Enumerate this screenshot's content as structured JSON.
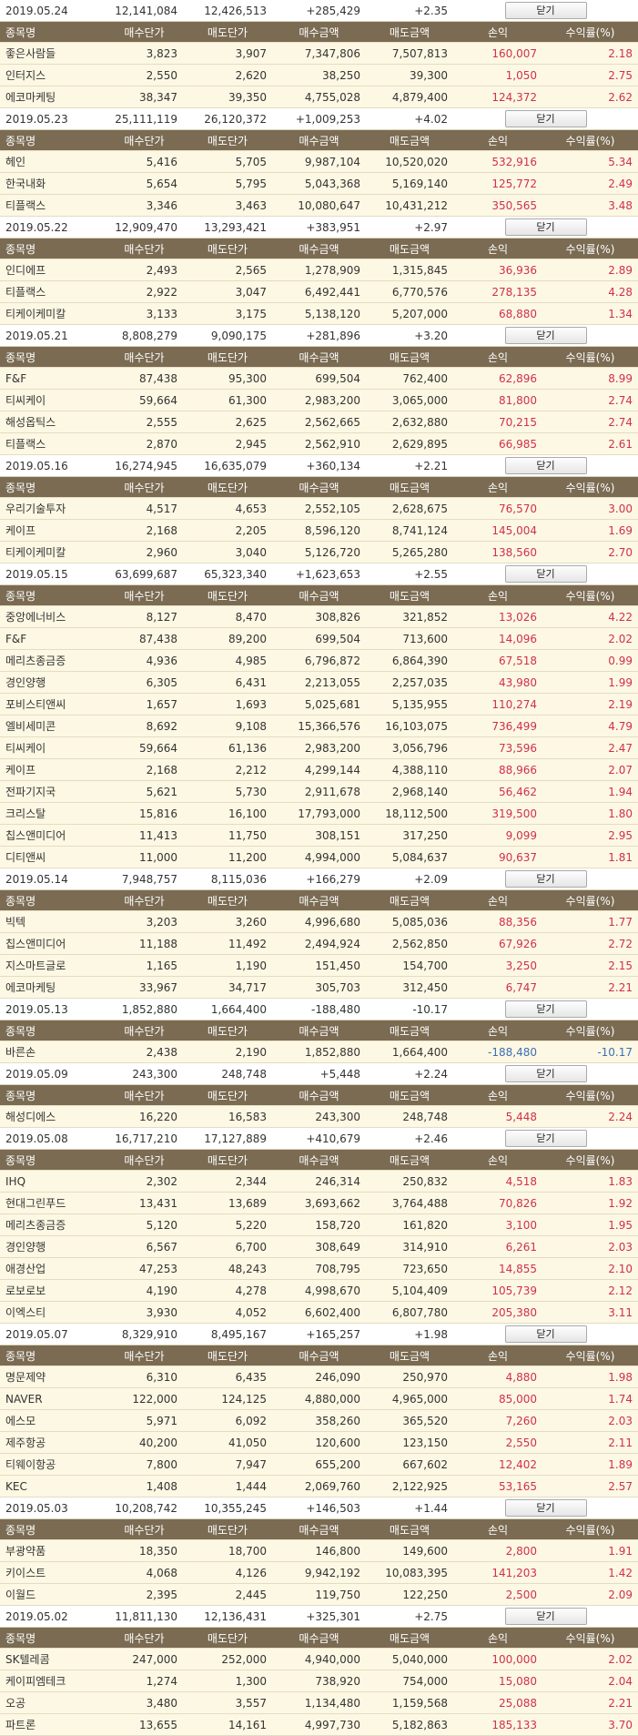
{
  "headers": [
    "종목명",
    "매수단가",
    "매도단가",
    "매수금액",
    "매도금액",
    "손익",
    "수익률(%)"
  ],
  "close_label": "닫기",
  "colors": {
    "positive": "#d0304a",
    "negative": "#3a6fb8",
    "header_bg": "#7a6b52",
    "row_bg": "#fdf8e3"
  },
  "groups": [
    {
      "date": "2019.05.24",
      "buy_total": "12,141,084",
      "sell_total": "12,426,513",
      "profit": "+285,429",
      "rate": "+2.35",
      "rows": [
        [
          "좋은사람들",
          "3,823",
          "3,907",
          "7,347,806",
          "7,507,813",
          "160,007",
          "2.18"
        ],
        [
          "인터지스",
          "2,550",
          "2,620",
          "38,250",
          "39,300",
          "1,050",
          "2.75"
        ],
        [
          "에코마케팅",
          "38,347",
          "39,350",
          "4,755,028",
          "4,879,400",
          "124,372",
          "2.62"
        ]
      ]
    },
    {
      "date": "2019.05.23",
      "buy_total": "25,111,119",
      "sell_total": "26,120,372",
      "profit": "+1,009,253",
      "rate": "+4.02",
      "rows": [
        [
          "헤인",
          "5,416",
          "5,705",
          "9,987,104",
          "10,520,020",
          "532,916",
          "5.34"
        ],
        [
          "한국내화",
          "5,654",
          "5,795",
          "5,043,368",
          "5,169,140",
          "125,772",
          "2.49"
        ],
        [
          "티플랙스",
          "3,346",
          "3,463",
          "10,080,647",
          "10,431,212",
          "350,565",
          "3.48"
        ]
      ]
    },
    {
      "date": "2019.05.22",
      "buy_total": "12,909,470",
      "sell_total": "13,293,421",
      "profit": "+383,951",
      "rate": "+2.97",
      "rows": [
        [
          "인디에프",
          "2,493",
          "2,565",
          "1,278,909",
          "1,315,845",
          "36,936",
          "2.89"
        ],
        [
          "티플랙스",
          "2,922",
          "3,047",
          "6,492,441",
          "6,770,576",
          "278,135",
          "4.28"
        ],
        [
          "티케이케미칼",
          "3,133",
          "3,175",
          "5,138,120",
          "5,207,000",
          "68,880",
          "1.34"
        ]
      ]
    },
    {
      "date": "2019.05.21",
      "buy_total": "8,808,279",
      "sell_total": "9,090,175",
      "profit": "+281,896",
      "rate": "+3.20",
      "rows": [
        [
          "F&F",
          "87,438",
          "95,300",
          "699,504",
          "762,400",
          "62,896",
          "8.99"
        ],
        [
          "티씨케이",
          "59,664",
          "61,300",
          "2,983,200",
          "3,065,000",
          "81,800",
          "2.74"
        ],
        [
          "해성옵틱스",
          "2,555",
          "2,625",
          "2,562,665",
          "2,632,880",
          "70,215",
          "2.74"
        ],
        [
          "티플랙스",
          "2,870",
          "2,945",
          "2,562,910",
          "2,629,895",
          "66,985",
          "2.61"
        ]
      ]
    },
    {
      "date": "2019.05.16",
      "buy_total": "16,274,945",
      "sell_total": "16,635,079",
      "profit": "+360,134",
      "rate": "+2.21",
      "rows": [
        [
          "우리기술투자",
          "4,517",
          "4,653",
          "2,552,105",
          "2,628,675",
          "76,570",
          "3.00"
        ],
        [
          "케이프",
          "2,168",
          "2,205",
          "8,596,120",
          "8,741,124",
          "145,004",
          "1.69"
        ],
        [
          "티케이케미칼",
          "2,960",
          "3,040",
          "5,126,720",
          "5,265,280",
          "138,560",
          "2.70"
        ]
      ]
    },
    {
      "date": "2019.05.15",
      "buy_total": "63,699,687",
      "sell_total": "65,323,340",
      "profit": "+1,623,653",
      "rate": "+2.55",
      "rows": [
        [
          "중앙에너비스",
          "8,127",
          "8,470",
          "308,826",
          "321,852",
          "13,026",
          "4.22"
        ],
        [
          "F&F",
          "87,438",
          "89,200",
          "699,504",
          "713,600",
          "14,096",
          "2.02"
        ],
        [
          "메리츠종금증",
          "4,936",
          "4,985",
          "6,796,872",
          "6,864,390",
          "67,518",
          "0.99"
        ],
        [
          "경인양행",
          "6,305",
          "6,431",
          "2,213,055",
          "2,257,035",
          "43,980",
          "1.99"
        ],
        [
          "포비스티앤씨",
          "1,657",
          "1,693",
          "5,025,681",
          "5,135,955",
          "110,274",
          "2.19"
        ],
        [
          "엘비세미콘",
          "8,692",
          "9,108",
          "15,366,576",
          "16,103,075",
          "736,499",
          "4.79"
        ],
        [
          "티씨케이",
          "59,664",
          "61,136",
          "2,983,200",
          "3,056,796",
          "73,596",
          "2.47"
        ],
        [
          "케이프",
          "2,168",
          "2,212",
          "4,299,144",
          "4,388,110",
          "88,966",
          "2.07"
        ],
        [
          "전파기지국",
          "5,621",
          "5,730",
          "2,911,678",
          "2,968,140",
          "56,462",
          "1.94"
        ],
        [
          "크리스탈",
          "15,816",
          "16,100",
          "17,793,000",
          "18,112,500",
          "319,500",
          "1.80"
        ],
        [
          "칩스앤미디어",
          "11,413",
          "11,750",
          "308,151",
          "317,250",
          "9,099",
          "2.95"
        ],
        [
          "디티앤씨",
          "11,000",
          "11,200",
          "4,994,000",
          "5,084,637",
          "90,637",
          "1.81"
        ]
      ]
    },
    {
      "date": "2019.05.14",
      "buy_total": "7,948,757",
      "sell_total": "8,115,036",
      "profit": "+166,279",
      "rate": "+2.09",
      "rows": [
        [
          "빅텍",
          "3,203",
          "3,260",
          "4,996,680",
          "5,085,036",
          "88,356",
          "1.77"
        ],
        [
          "칩스앤미디어",
          "11,188",
          "11,492",
          "2,494,924",
          "2,562,850",
          "67,926",
          "2.72"
        ],
        [
          "지스마트글로",
          "1,165",
          "1,190",
          "151,450",
          "154,700",
          "3,250",
          "2.15"
        ],
        [
          "에코마케팅",
          "33,967",
          "34,717",
          "305,703",
          "312,450",
          "6,747",
          "2.21"
        ]
      ]
    },
    {
      "date": "2019.05.13",
      "buy_total": "1,852,880",
      "sell_total": "1,664,400",
      "profit": "-188,480",
      "rate": "-10.17",
      "rows": [
        [
          "바른손",
          "2,438",
          "2,190",
          "1,852,880",
          "1,664,400",
          "-188,480",
          "-10.17"
        ]
      ]
    },
    {
      "date": "2019.05.09",
      "buy_total": "243,300",
      "sell_total": "248,748",
      "profit": "+5,448",
      "rate": "+2.24",
      "rows": [
        [
          "해성디에스",
          "16,220",
          "16,583",
          "243,300",
          "248,748",
          "5,448",
          "2.24"
        ]
      ]
    },
    {
      "date": "2019.05.08",
      "buy_total": "16,717,210",
      "sell_total": "17,127,889",
      "profit": "+410,679",
      "rate": "+2.46",
      "rows": [
        [
          "IHQ",
          "2,302",
          "2,344",
          "246,314",
          "250,832",
          "4,518",
          "1.83"
        ],
        [
          "현대그린푸드",
          "13,431",
          "13,689",
          "3,693,662",
          "3,764,488",
          "70,826",
          "1.92"
        ],
        [
          "메리츠종금증",
          "5,120",
          "5,220",
          "158,720",
          "161,820",
          "3,100",
          "1.95"
        ],
        [
          "경인양행",
          "6,567",
          "6,700",
          "308,649",
          "314,910",
          "6,261",
          "2.03"
        ],
        [
          "애경산업",
          "47,253",
          "48,243",
          "708,795",
          "723,650",
          "14,855",
          "2.10"
        ],
        [
          "로보로보",
          "4,190",
          "4,278",
          "4,998,670",
          "5,104,409",
          "105,739",
          "2.12"
        ],
        [
          "이엑스티",
          "3,930",
          "4,052",
          "6,602,400",
          "6,807,780",
          "205,380",
          "3.11"
        ]
      ]
    },
    {
      "date": "2019.05.07",
      "buy_total": "8,329,910",
      "sell_total": "8,495,167",
      "profit": "+165,257",
      "rate": "+1.98",
      "rows": [
        [
          "명문제약",
          "6,310",
          "6,435",
          "246,090",
          "250,970",
          "4,880",
          "1.98"
        ],
        [
          "NAVER",
          "122,000",
          "124,125",
          "4,880,000",
          "4,965,000",
          "85,000",
          "1.74"
        ],
        [
          "에스모",
          "5,971",
          "6,092",
          "358,260",
          "365,520",
          "7,260",
          "2.03"
        ],
        [
          "제주항공",
          "40,200",
          "41,050",
          "120,600",
          "123,150",
          "2,550",
          "2.11"
        ],
        [
          "티웨이항공",
          "7,800",
          "7,947",
          "655,200",
          "667,602",
          "12,402",
          "1.89"
        ],
        [
          "KEC",
          "1,408",
          "1,444",
          "2,069,760",
          "2,122,925",
          "53,165",
          "2.57"
        ]
      ]
    },
    {
      "date": "2019.05.03",
      "buy_total": "10,208,742",
      "sell_total": "10,355,245",
      "profit": "+146,503",
      "rate": "+1.44",
      "rows": [
        [
          "부광약품",
          "18,350",
          "18,700",
          "146,800",
          "149,600",
          "2,800",
          "1.91"
        ],
        [
          "키이스트",
          "4,068",
          "4,126",
          "9,942,192",
          "10,083,395",
          "141,203",
          "1.42"
        ],
        [
          "이월드",
          "2,395",
          "2,445",
          "119,750",
          "122,250",
          "2,500",
          "2.09"
        ]
      ]
    },
    {
      "date": "2019.05.02",
      "buy_total": "11,811,130",
      "sell_total": "12,136,431",
      "profit": "+325,301",
      "rate": "+2.75",
      "rows": [
        [
          "SK텔레콤",
          "247,000",
          "252,000",
          "4,940,000",
          "5,040,000",
          "100,000",
          "2.02"
        ],
        [
          "케이피엠테크",
          "1,274",
          "1,300",
          "738,920",
          "754,000",
          "15,080",
          "2.04"
        ],
        [
          "오공",
          "3,480",
          "3,557",
          "1,134,480",
          "1,159,568",
          "25,088",
          "2.21"
        ],
        [
          "파트론",
          "13,655",
          "14,161",
          "4,997,730",
          "5,182,863",
          "185,133",
          "3.70"
        ]
      ]
    }
  ]
}
